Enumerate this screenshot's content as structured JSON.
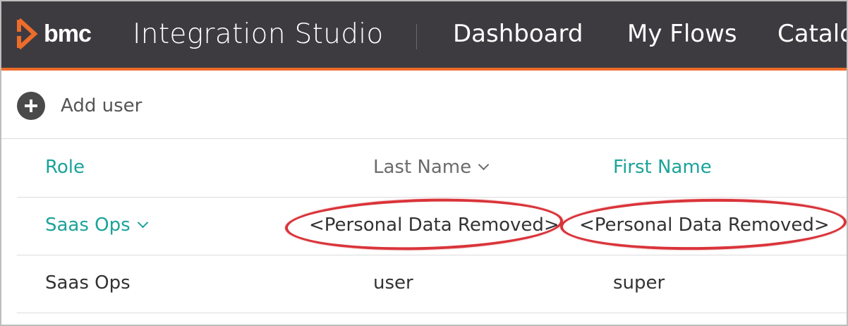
{
  "header": {
    "brand": "bmc",
    "product": "Integration Studio",
    "nav": [
      "Dashboard",
      "My Flows",
      "Catalo"
    ],
    "accent_color": "#ee6c2a",
    "bar_color": "#3d3b40"
  },
  "toolbar": {
    "add_user_label": "Add user",
    "add_icon": "plus-circle-icon"
  },
  "table": {
    "columns": [
      "Role",
      "Last Name",
      "First Name"
    ],
    "rows": [
      {
        "role": "Saas Ops",
        "last_name": "<Personal Data Removed>",
        "first_name": "<Personal Data Removed>"
      },
      {
        "role": "Saas Ops",
        "last_name": "user",
        "first_name": "super"
      }
    ],
    "link_color": "#1ba39a"
  }
}
